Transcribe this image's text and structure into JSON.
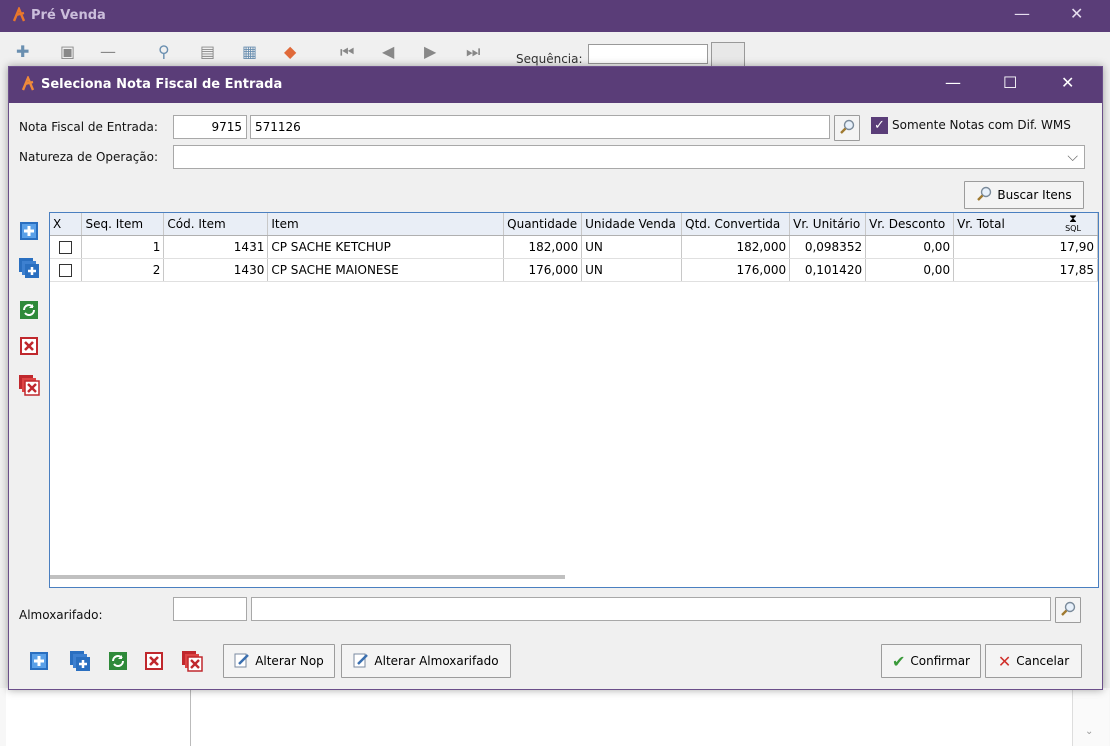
{
  "background_window": {
    "title": "Pré Venda",
    "sequence_label": "Sequência:",
    "controls": {
      "minimize": "—",
      "close": "✕"
    }
  },
  "dialog": {
    "title": "Seleciona Nota Fiscal de Entrada",
    "controls": {
      "minimize": "—",
      "maximize": "☐",
      "close": "✕"
    },
    "nota_fiscal": {
      "label": "Nota Fiscal de Entrada:",
      "code": "9715",
      "number": "571126"
    },
    "somente_notas": {
      "label": "Somente Notas com Dif. WMS",
      "checked": true
    },
    "natureza": {
      "label": "Natureza de Operação:",
      "value": ""
    },
    "buscar_itens_label": "Buscar Itens",
    "grid": {
      "columns": [
        "X",
        "Seq. Item",
        "Cód. Item",
        "Item",
        "Quantidade",
        "Unidade Venda",
        "Qtd. Convertida",
        "Vr. Unitário",
        "Vr. Desconto",
        "Vr. Total"
      ],
      "sql_badge": "SQL",
      "rows": [
        {
          "seq": "1",
          "cod": "1431",
          "item": "CP SACHE KETCHUP",
          "quantidade": "182,000",
          "unidade": "UN",
          "qtd_convertida": "182,000",
          "vr_unitario": "0,098352",
          "vr_desconto": "0,00",
          "vr_total": "17,90"
        },
        {
          "seq": "2",
          "cod": "1430",
          "item": "CP SACHE MAIONESE",
          "quantidade": "176,000",
          "unidade": "UN",
          "qtd_convertida": "176,000",
          "vr_unitario": "0,101420",
          "vr_desconto": "0,00",
          "vr_total": "17,85"
        }
      ]
    },
    "almoxarifado": {
      "label": "Almoxarifado:",
      "code": "",
      "name": ""
    },
    "buttons": {
      "alterar_nop": "Alterar Nop",
      "alterar_almoxarifado": "Alterar Almoxarifado",
      "confirmar": "Confirmar",
      "cancelar": "Cancelar"
    }
  },
  "colors": {
    "titlebar": "#5a3d78",
    "grid_border": "#4a7fc0",
    "icon_blue": "#2a6fc0",
    "icon_green": "#2f8a3a",
    "icon_red": "#c0282d"
  }
}
